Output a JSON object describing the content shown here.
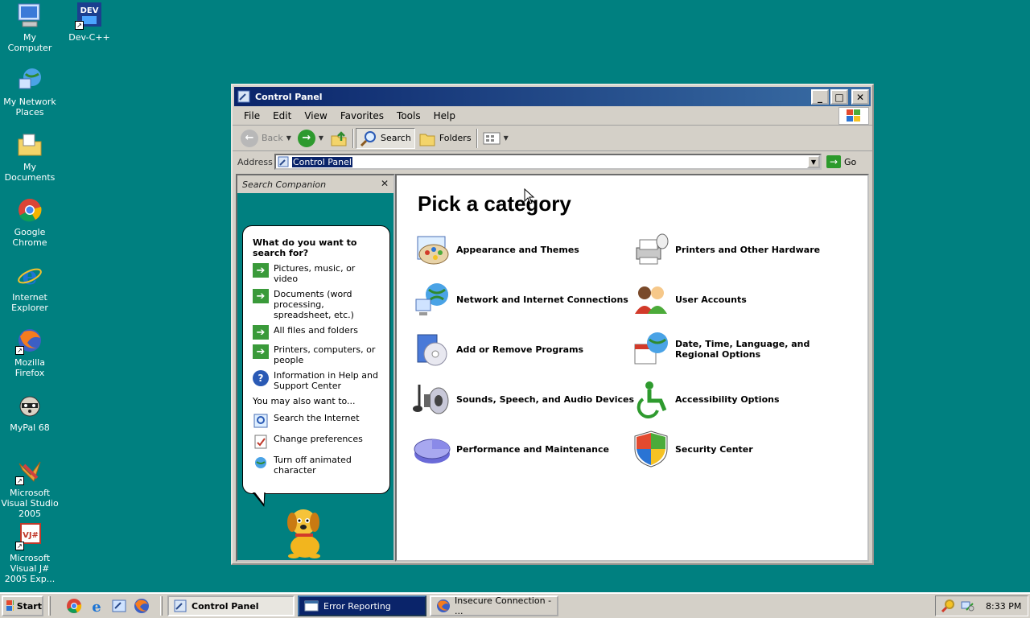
{
  "desktop": {
    "icons": [
      {
        "label": "My Computer"
      },
      {
        "label": "Dev-C++",
        "badge": "DEV"
      },
      {
        "label": "My Network Places"
      },
      {
        "label": "My Documents"
      },
      {
        "label": "Google Chrome"
      },
      {
        "label": "Internet Explorer"
      },
      {
        "label": "Mozilla Firefox"
      },
      {
        "label": "MyPal 68"
      },
      {
        "label": "Microsoft Visual Studio 2005"
      },
      {
        "label": "Microsoft Visual J# 2005 Exp...",
        "badge": "VJ#"
      }
    ]
  },
  "window": {
    "title": "Control Panel",
    "controls": {
      "minimize": "_",
      "maximize": "□",
      "close": "✕"
    },
    "menu": [
      "File",
      "Edit",
      "View",
      "Favorites",
      "Tools",
      "Help"
    ],
    "toolbar": {
      "back": "Back",
      "search": "Search",
      "folders": "Folders"
    },
    "address": {
      "label": "Address",
      "value": "Control Panel",
      "go": "Go"
    }
  },
  "search_companion": {
    "header": "Search Companion",
    "close": "✕",
    "question": "What do you want to search for?",
    "options": [
      "Pictures, music, or video",
      "Documents (word processing, spreadsheet, etc.)",
      "All files and folders",
      "Printers, computers, or people",
      "Information in Help and Support Center"
    ],
    "also_label": "You may also want to...",
    "also": [
      "Search the Internet",
      "Change preferences",
      "Turn off animated character"
    ]
  },
  "main": {
    "title": "Pick a category",
    "categories": [
      "Appearance and Themes",
      "Printers and Other Hardware",
      "Network and Internet Connections",
      "User Accounts",
      "Add or Remove Programs",
      "Date, Time, Language, and Regional Options",
      "Sounds, Speech, and Audio Devices",
      "Accessibility Options",
      "Performance and Maintenance",
      "Security Center"
    ]
  },
  "taskbar": {
    "start": "Start",
    "tasks": [
      "Control Panel",
      "Error Reporting",
      "Insecure Connection - ..."
    ],
    "clock": "8:33 PM"
  }
}
